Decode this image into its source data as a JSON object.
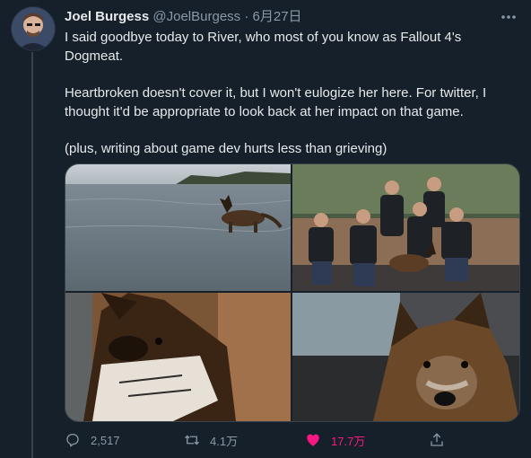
{
  "tweet": {
    "author_name": "Joel Burgess",
    "author_handle": "@JoelBurgess",
    "separator": "·",
    "date": "6月27日",
    "paragraphs": [
      "I said goodbye today to River, who most of you know as Fallout 4's Dogmeat.",
      "Heartbroken doesn't cover it, but I won't eulogize her here. For twitter, I thought it'd be appropriate to look back at her impact on that game.",
      "(plus, writing about game dev hurts less than grieving)"
    ]
  },
  "actions": {
    "reply_count": "2,517",
    "retweet_count": "4.1万",
    "like_count": "17.7万"
  },
  "icons": {
    "more": "more-dots-icon",
    "reply": "reply-icon",
    "retweet": "retweet-icon",
    "like": "heart-icon",
    "share": "share-icon"
  },
  "colors": {
    "background": "#15202b",
    "text": "#e7e9ea",
    "secondary": "#8b98a5",
    "like": "#f91880",
    "border": "#38444d"
  }
}
